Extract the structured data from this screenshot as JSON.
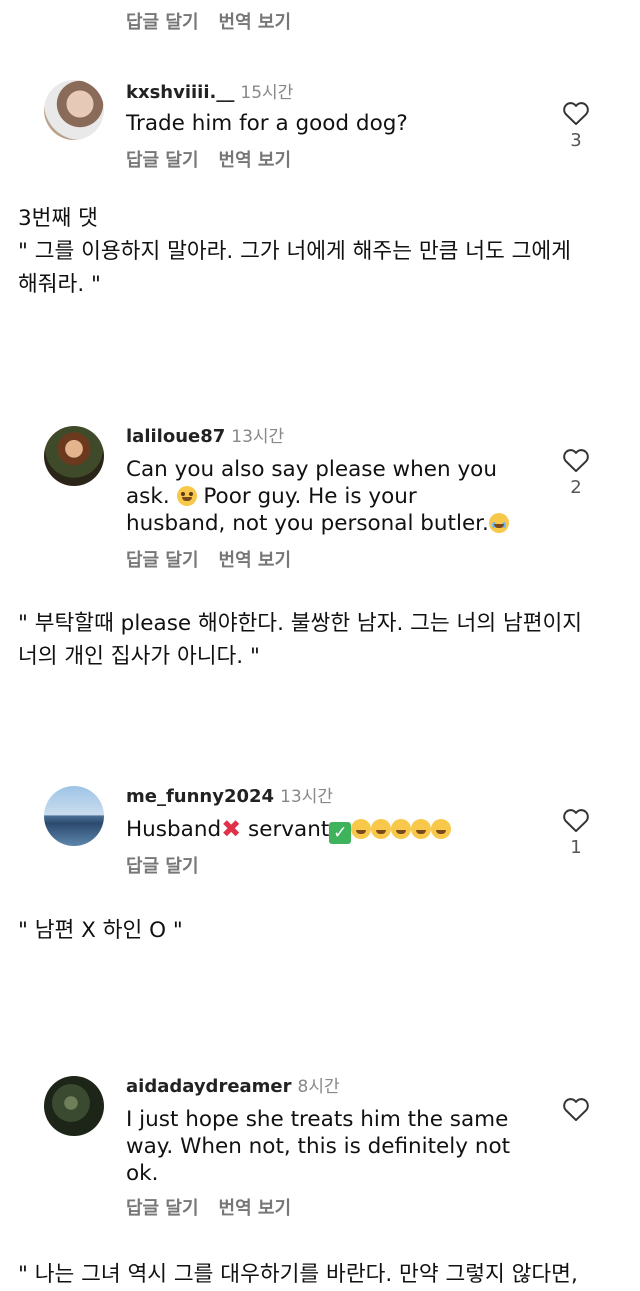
{
  "actions": {
    "reply": "답글 달기",
    "translate": "번역 보기"
  },
  "comments": [
    {
      "username": "kxshviiii.__",
      "time": "15시간",
      "text": "Trade him for a good dog?",
      "likes": "3"
    },
    {
      "username": "laliloue87",
      "time": "13시간",
      "text_line1": "Can you also say please when you",
      "text_line2": "ask.",
      "text_line2b": "Poor guy. He is your",
      "text_line3": "husband, not you personal butler.",
      "likes": "2"
    },
    {
      "username": "me_funny2024",
      "time": "13시간",
      "text_a": "Husband",
      "text_b": " servant",
      "likes": "1"
    },
    {
      "username": "aidadaydreamer",
      "time": "8시간",
      "text_line1": "I just hope she treats him the same",
      "text_line2": "way. When not, this is definitely not",
      "text_line3": "ok."
    }
  ],
  "translations": {
    "t1_label": "3번째 댓",
    "t1_line1": "\" 그를 이용하지 말아라. 그가 너에게 해주는 만큼 너도 그에게",
    "t1_line2": "해줘라. \"",
    "t2_line1": "\" 부탁할때 please 해야한다. 불쌍한 남자. 그는 너의 남편이지",
    "t2_line2": "너의 개인 집사가 아니다. \"",
    "t3_line1": "\" 남편 X 하인 O \"",
    "t4_line1": "\" 나는 그녀 역시 그를 대우하기를 바란다. 만약 그렇지 않다면,"
  },
  "icons": {
    "like": "heart-outline-icon",
    "laugh": "tears-of-joy-icon",
    "plead": "pleading-face-icon",
    "tear": "crying-face-icon"
  }
}
